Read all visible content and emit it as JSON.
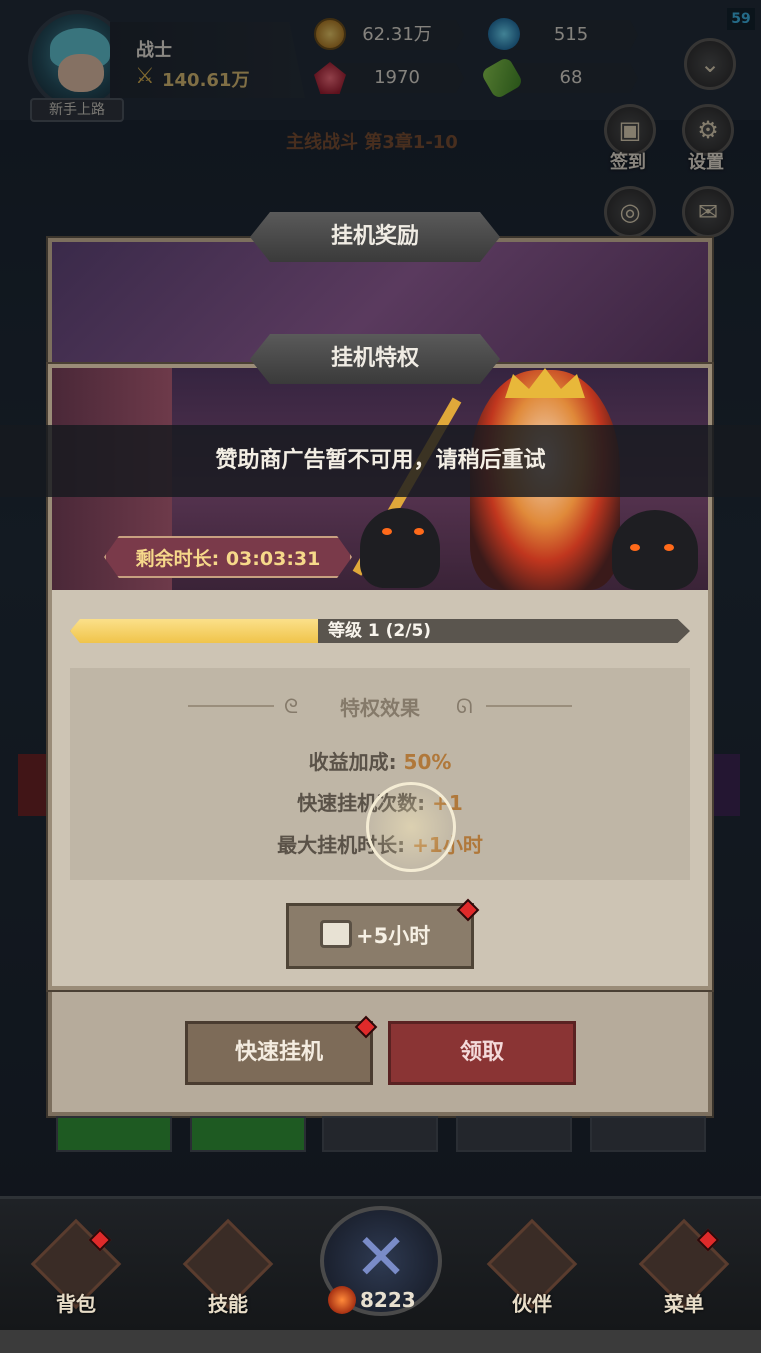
{
  "hud": {
    "fps": "59",
    "player_name": "战士",
    "power": "140.61万",
    "rank": "新手上路",
    "gold": "62.31万",
    "orbs": "515",
    "gems": "1970",
    "tickets": "68"
  },
  "side_menu": {
    "checkin": "签到",
    "settings": "设置"
  },
  "battle": {
    "chapter_label": "主线战斗 第3章1-10"
  },
  "reward_panel": {
    "title": "挂机奖励",
    "quick_idle": "快速挂机",
    "claim": "领取"
  },
  "perk_panel": {
    "title": "挂机特权",
    "timer": "剩余时长: 03:03:31",
    "level_text": "等级 1 (2/5)",
    "level_progress": 0.4,
    "effects_title": "特权效果",
    "effects": [
      {
        "label": "收益加成:",
        "value": "50%"
      },
      {
        "label": "快速挂机次数:",
        "value": "+1"
      },
      {
        "label": "最大挂机时长:",
        "value": "+1小时"
      }
    ],
    "ad_button": "+5小时"
  },
  "toast": {
    "message": "赞助商广告暂不可用，请稍后重试"
  },
  "bottom_nav": {
    "bag": "背包",
    "skills": "技能",
    "battle_count": "8223",
    "partners": "伙伴",
    "menu": "菜单"
  },
  "colors": {
    "accent_gold": "#f0c44a",
    "claim_red": "#8a3434",
    "value_orange": "#b0783a",
    "fps_blue": "#3ab6e8"
  },
  "icons": [
    "gold-coin-icon",
    "red-gem-icon",
    "blue-orb-icon",
    "green-ticket-icon",
    "crossed-swords-icon",
    "tv-icon",
    "chevron-down-icon",
    "gear-icon",
    "calendar-icon",
    "mail-icon"
  ]
}
